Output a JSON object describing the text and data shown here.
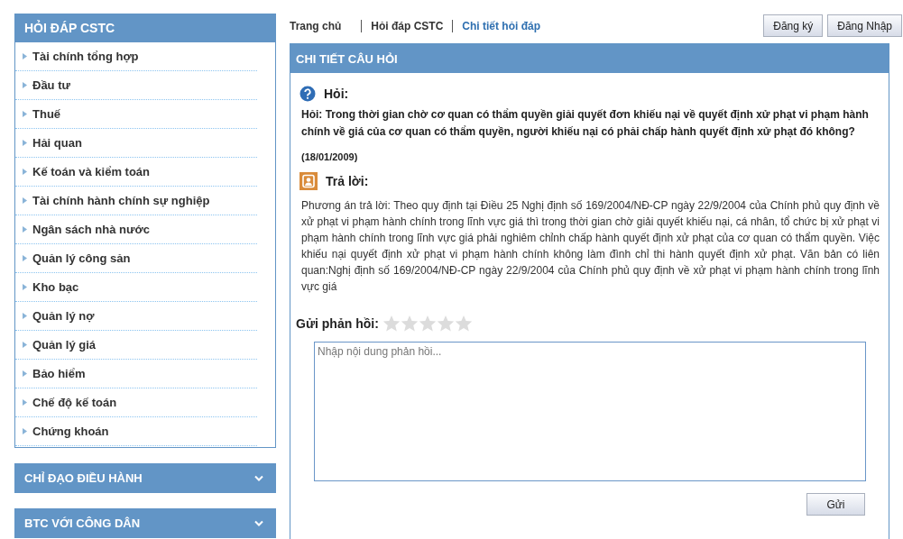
{
  "sidebar": {
    "title": "HỎI ĐÁP CSTC",
    "items": [
      {
        "label": "Tài chính tổng hợp"
      },
      {
        "label": "Đầu tư"
      },
      {
        "label": "Thuế"
      },
      {
        "label": "Hải quan"
      },
      {
        "label": "Kế toán và kiểm toán"
      },
      {
        "label": "Tài chính hành chính sự nghiệp"
      },
      {
        "label": "Ngân sách nhà nước"
      },
      {
        "label": "Quản lý công sản"
      },
      {
        "label": "Kho bạc"
      },
      {
        "label": "Quản lý nợ"
      },
      {
        "label": "Quản lý giá"
      },
      {
        "label": "Bảo hiểm"
      },
      {
        "label": "Chế độ kế toán"
      },
      {
        "label": "Chứng khoán"
      }
    ],
    "sections": [
      {
        "title": "CHỈ ĐẠO ĐIỀU HÀNH",
        "expanded": false
      },
      {
        "title": "BTC VỚI CÔNG DÂN",
        "expanded": false
      }
    ]
  },
  "breadcrumb": [
    {
      "label": "Trang chủ",
      "selected": false
    },
    {
      "label": "Hỏi đáp CSTC",
      "selected": false
    },
    {
      "label": "Chi tiết hỏi đáp",
      "selected": true
    }
  ],
  "auth_buttons": [
    "Đăng ký",
    "Đăng Nhập"
  ],
  "panel": {
    "title": "CHI TIẾT CÂU HỎI",
    "question_label": "Hỏi:",
    "question": "Hỏi: Trong thời gian chờ cơ quan có thẩm quyền giải quyết đơn khiếu nại về quyết định xử phạt vi phạm hành chính về giá của cơ quan có thẩm quyền, người khiếu nại có phải chấp hành quyết định xử phạt đó không?",
    "date": "(18/01/2009)",
    "answer_label": "Trả lời:",
    "answer": "Phương án trả lời: Theo quy định tại Điều 25 Nghị định số 169/2004/NĐ-CP ngày 22/9/2004 của Chính phủ quy định về xử phạt vi phạm hành chính trong lĩnh vực giá thì trong thời gian chờ giải quyết khiếu nại, cá nhân, tổ chức bị xử phạt  vi phạm hành chính trong lĩnh vực giá phải nghiêm chỉnh chấp hành quyết định xử phạt của cơ quan có thẩm quyền. Việc khiếu nại quyết định xử phạt vi phạm hành chính không làm đình chỉ thi hành quyết định xử phạt.  Văn bản có liên quan:Nghị định số 169/2004/NĐ-CP ngày 22/9/2004 của Chính phủ quy định về xử phạt vi phạm hành chính trong lĩnh vực giá",
    "feedback": {
      "label": "Gửi phản hồi:",
      "stars": 0,
      "placeholder": "Nhập nội dung phản hồi...",
      "submit": "Gửi"
    }
  }
}
